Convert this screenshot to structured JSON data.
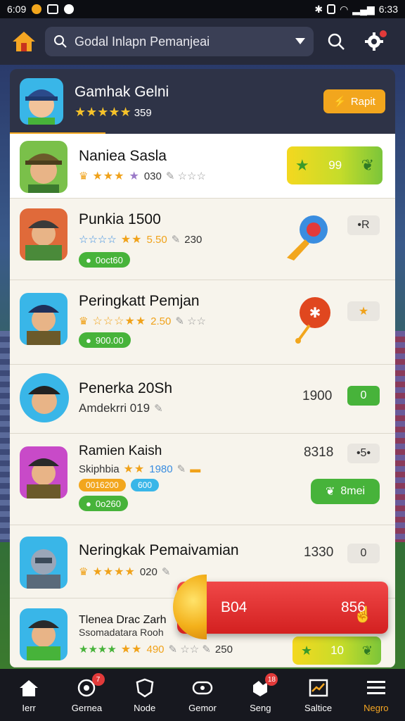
{
  "status_bar": {
    "time_left": "6:09",
    "time_right": "6:33"
  },
  "search": {
    "text": "Godal Inlapn Pemanjeai"
  },
  "top_card": {
    "title": "Gamhak Gelni",
    "rating_text": "359",
    "button_label": "Rapit"
  },
  "rows": [
    {
      "title": "Naniea Sasla",
      "rating_text": "030",
      "button_value": "99"
    },
    {
      "title": "Punkia 1500",
      "rating_text": "5.50",
      "count_text": "230",
      "pill": "0oct60",
      "chip": "•R"
    },
    {
      "title": "Peringkatt Pemjan",
      "rating_text": "2.50",
      "pill": "900.00",
      "chip": "★"
    },
    {
      "title": "Penerka 20Sh",
      "subtitle": "Amdekrri 019",
      "right_num": "1900",
      "chip": "0"
    },
    {
      "title": "Ramien Kaish",
      "subtitle": "Skiphbia",
      "rating_text": "1980",
      "right_num": "8318",
      "chip": "•5•",
      "pill_orange": "0016200",
      "pill_cyan": "600",
      "pill_green": "0o260",
      "button_label": "8mei"
    },
    {
      "title": "Neringkak Pemaivamian",
      "rating_text": "020",
      "right_num": "1330",
      "chip": "0"
    },
    {
      "title": "Tlenea Drac Zarh",
      "subtitle": "Ssomadatara Rooh",
      "rating_text": "490",
      "count_text": "250",
      "button_value": "10"
    }
  ],
  "promo": {
    "left_label": "B04",
    "right_label": "856"
  },
  "nav": [
    {
      "label": "Ierr",
      "icon": "home-icon"
    },
    {
      "label": "Gernea",
      "icon": "trophy-icon",
      "badge": "7"
    },
    {
      "label": "Node",
      "icon": "shield-icon"
    },
    {
      "label": "Gemor",
      "icon": "controller-icon"
    },
    {
      "label": "Seng",
      "icon": "puzzle-icon",
      "badge": "18"
    },
    {
      "label": "Saltice",
      "icon": "chart-icon"
    },
    {
      "label": "Negro",
      "icon": "menu-icon",
      "active": true
    }
  ],
  "colors": {
    "accent": "#f5a623",
    "green": "#47b33a",
    "red": "#e23a3a",
    "header": "#262a3b"
  }
}
